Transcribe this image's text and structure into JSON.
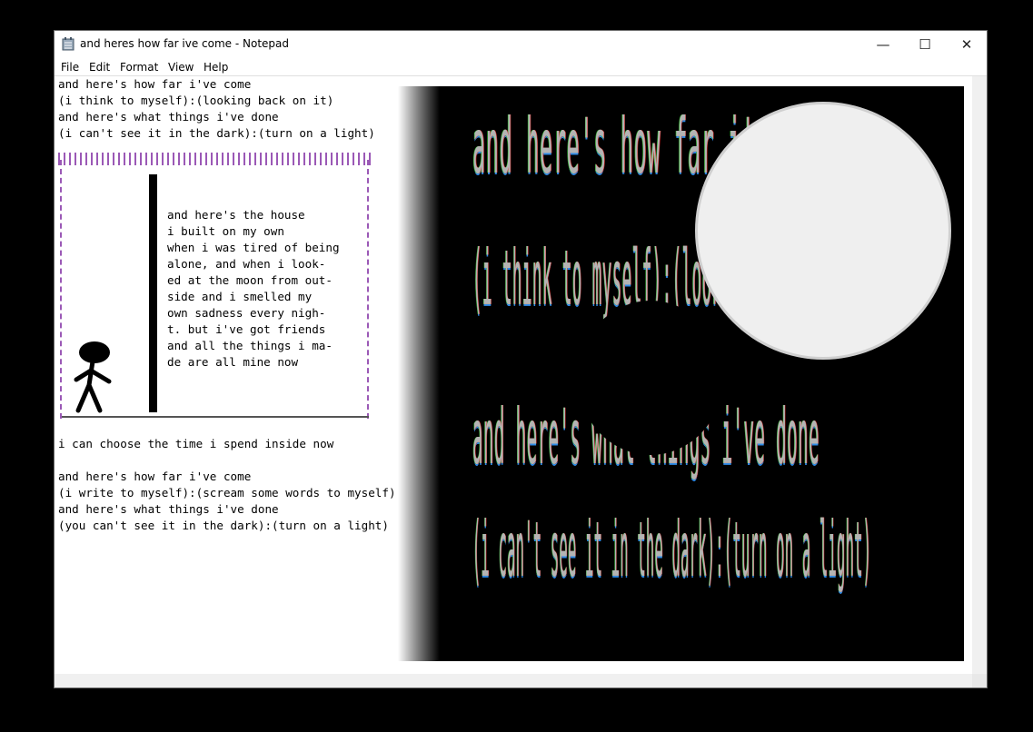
{
  "window": {
    "title": "and heres how far ive come - Notepad",
    "minimize_symbol": "—",
    "maximize_symbol": "☐",
    "close_symbol": "✕"
  },
  "menu": [
    "File",
    "Edit",
    "Format",
    "View",
    "Help"
  ],
  "editor": {
    "intro_lines": [
      "and here's how far i've come",
      "(i think to myself):(looking back on it)",
      "and here's what things i've done",
      "(i can't see it in the dark):(turn on a light)"
    ],
    "house_lines": [
      "and here's the house",
      "i built on my own",
      "when i was tired of being",
      "alone, and when i look-",
      "ed at the moon from out-",
      "side and i smelled my",
      "own sadness every nigh-",
      "t. but i've got friends",
      "and all the things i ma-",
      "de are all mine now"
    ],
    "choose_line": "i can choose the time i spend inside now",
    "outro_lines": [
      "and here's how far i've come",
      "(i write to myself):(scream some words to myself)",
      "and here's what things i've done",
      "(you can't see it in the dark):(turn on a light)"
    ]
  },
  "art": {
    "lines": [
      "and here's how far i've come",
      "(i think to myself):(looking back on it)",
      "and here's what things i've done",
      "(i can't see it in the dark):(turn on a light)"
    ]
  },
  "colors": {
    "frame": "#9b59b6",
    "background": "#000000",
    "moon": "#efefef"
  }
}
